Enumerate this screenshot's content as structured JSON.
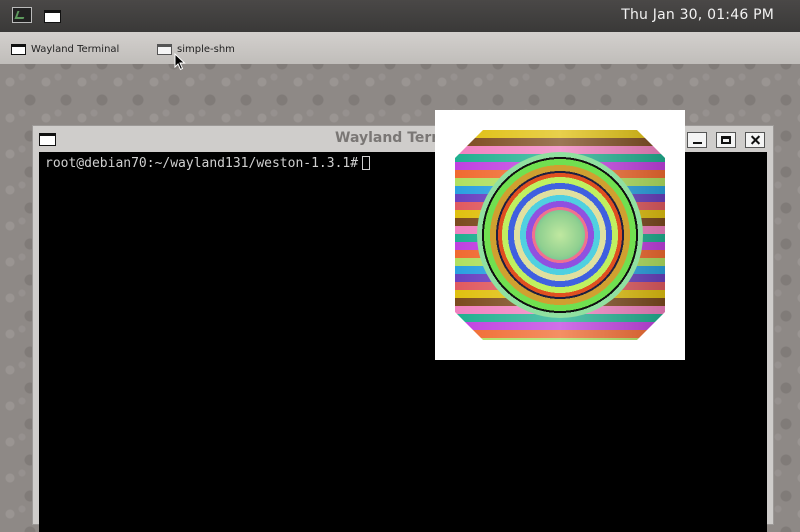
{
  "top_panel": {
    "clock": "Thu Jan 30, 01:46 PM",
    "launchers": [
      {
        "name": "terminal-launcher",
        "icon": "terminal-icon"
      },
      {
        "name": "window-launcher",
        "icon": "window-icon"
      }
    ]
  },
  "taskbar": {
    "items": [
      {
        "label": "Wayland Terminal",
        "icon": "window-icon"
      },
      {
        "label": "simple-shm",
        "icon": "window-icon"
      }
    ]
  },
  "terminal_window": {
    "title": "Wayland Termi",
    "prompt": "root@debian70:~/wayland131/weston-1.3.1#",
    "icons": [
      "window-icon",
      "minimize-icon",
      "maximize-icon",
      "close-icon"
    ]
  },
  "shm_window": {
    "description_icon": "shm-image"
  },
  "colors": {
    "panel": "#403f3d",
    "taskbar": "#c9c6c3",
    "terminal_bg": "#000000",
    "terminal_fg": "#d0d0d0",
    "clock": "#f2f2f2"
  }
}
